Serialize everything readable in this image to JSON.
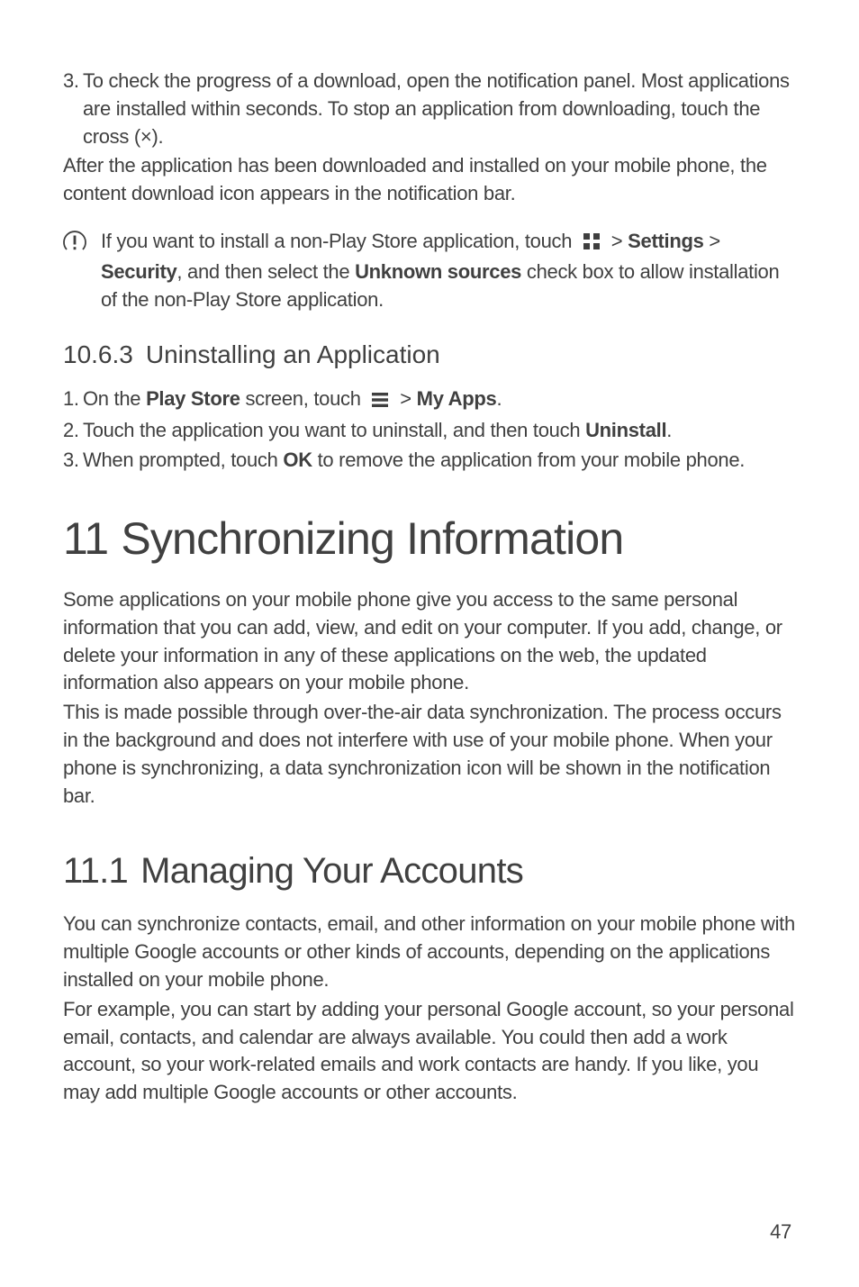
{
  "step3": {
    "num": "3.",
    "line1": "To check the progress of a download, open the notification panel. Most applications",
    "line2": "are installed within seconds. To stop an application from downloading, touch the",
    "line3": "cross (×)."
  },
  "afterPara": "After the application has been downloaded and installed on your mobile phone, the content download icon appears in the notification bar.",
  "note": {
    "pre": "If you want to install a non-Play Store application, touch ",
    "settings": "Settings",
    "security": "Security",
    "mid1": ", and then select the ",
    "unknown": "Unknown sources",
    "mid2": " check box to allow installation of the non-Play Store application.",
    "gt": " > "
  },
  "sec1063": {
    "num": "10.6.3",
    "title": "Uninstalling an Application"
  },
  "ustep1": {
    "num": "1.",
    "pre": "On the ",
    "playstore": "Play Store",
    "mid": " screen, touch ",
    "gt": " > ",
    "myapps": "My Apps",
    "post": "."
  },
  "ustep2": {
    "num": "2.",
    "pre": "Touch the application you want to uninstall, and then touch ",
    "uninstall": "Uninstall",
    "post": "."
  },
  "ustep3": {
    "num": "3.",
    "pre": "When prompted, touch ",
    "ok": "OK",
    "post": " to remove the application from your mobile phone."
  },
  "h11": {
    "num": "11",
    "title": "Synchronizing Information"
  },
  "syncP1": "Some applications on your mobile phone give you access to the same personal information that you can add, view, and edit on your computer. If you add, change, or delete your information in any of these applications on the web, the updated information also appears on your mobile phone.",
  "syncP2": "This is made possible through over-the-air data synchronization. The process occurs in the background and does not interfere with use of your mobile phone. When your phone is synchronizing, a data synchronization icon will be shown in the notification bar.",
  "h111": {
    "num": "11.1",
    "title": "Managing Your Accounts"
  },
  "accP1": "You can synchronize contacts, email, and other information on your mobile phone with multiple Google accounts or other kinds of accounts, depending on the applications installed on your mobile phone.",
  "accP2": "For example, you can start by adding your personal Google account, so your personal email, contacts, and calendar are always available. You could then add a work account, so your work-related emails and work contacts are handy. If you like, you may add multiple Google accounts or other accounts.",
  "pageNum": "47"
}
